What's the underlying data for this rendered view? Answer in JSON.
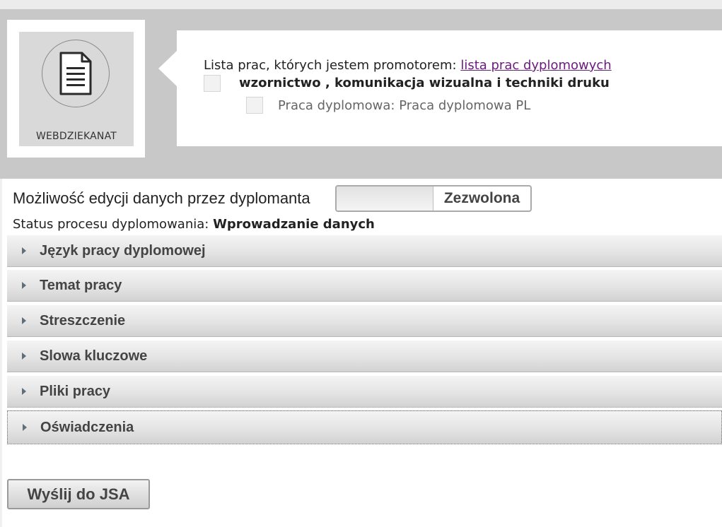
{
  "logo": {
    "text": "WEBDZIEKANAT",
    "icon": "document-icon"
  },
  "info": {
    "line1_prefix": "Lista prac, których jestem promotorem:",
    "line1_link": "lista prac dyplomowych",
    "line2": "wzornictwo , komunikacja wizualna i techniki druku",
    "line3": "Praca dyplomowa: Praca dyplomowa PL"
  },
  "edit": {
    "label": "Możliwość edycji danych przez dyplomanta",
    "toggle_value": "Zezwolona"
  },
  "status": {
    "label": "Status procesu dyplomowania:",
    "value": "Wprowadzanie danych"
  },
  "sections": [
    {
      "label": "Język pracy dyplomowej"
    },
    {
      "label": "Temat pracy"
    },
    {
      "label": "Streszczenie"
    },
    {
      "label": "Slowa kluczowe"
    },
    {
      "label": "Pliki pracy"
    },
    {
      "label": "Oświadczenia"
    }
  ],
  "send_button": "Wyślij do JSA",
  "colors": {
    "link": "#6b1b7f",
    "header_bg": "#c8c8c8"
  }
}
